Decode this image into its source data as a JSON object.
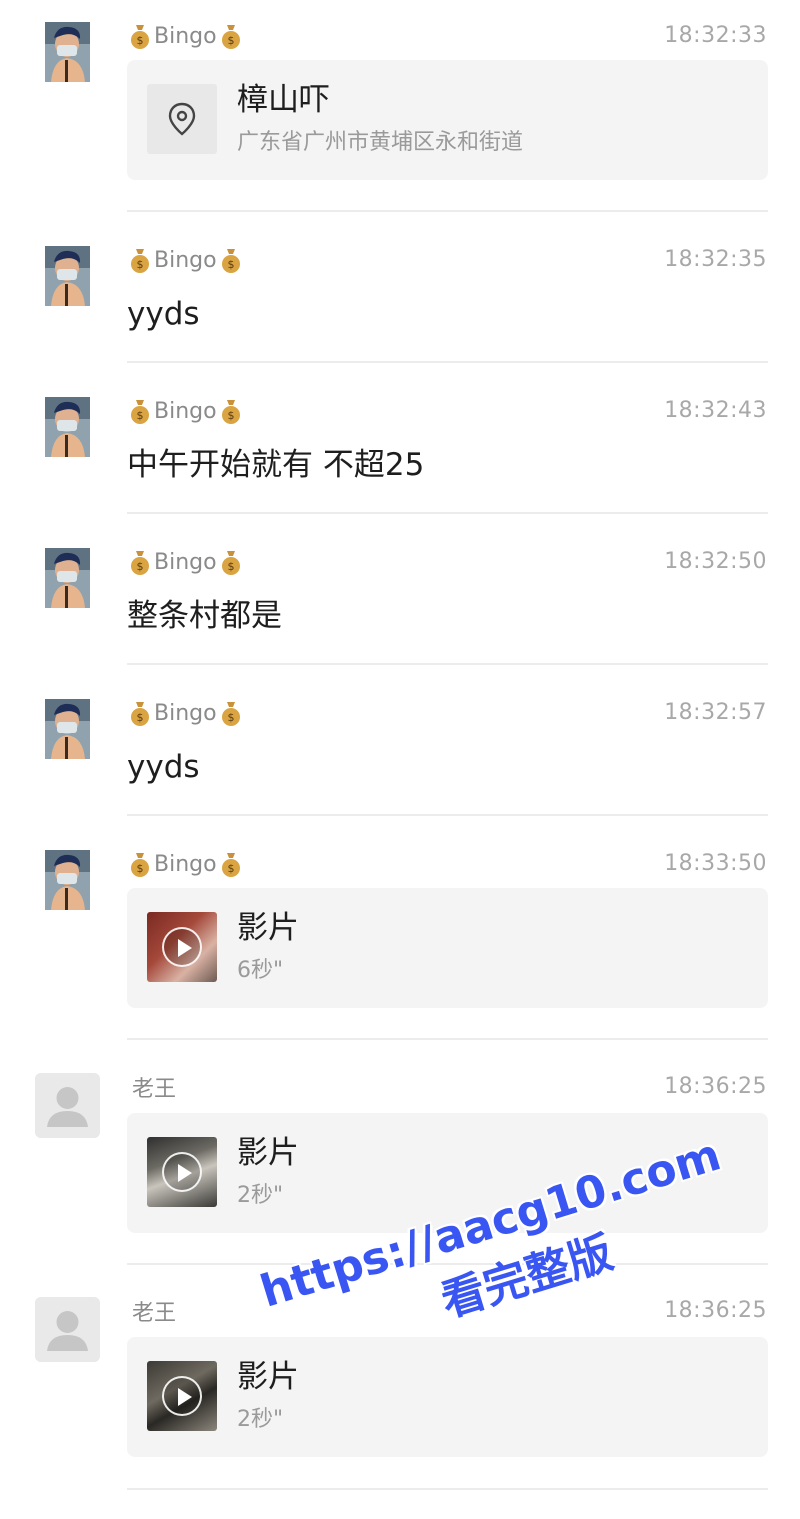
{
  "colors": {
    "background": "#ffffff",
    "card_background": "#f4f4f4",
    "sender_text": "#8a8a8a",
    "timestamp_text": "#a8a8a8",
    "watermark": "#3a56f2"
  },
  "messages": [
    {
      "sender": "Bingo",
      "sender_decoration_icon": "money-bag-icon",
      "avatar": "user-photo",
      "time": "18:32:33",
      "type": "location",
      "location": {
        "icon": "location-pin-icon",
        "title": "樟山吓",
        "address": "广东省广州市黄埔区永和街道"
      }
    },
    {
      "sender": "Bingo",
      "sender_decoration_icon": "money-bag-icon",
      "avatar": "user-photo",
      "time": "18:32:35",
      "type": "text",
      "text": "yyds"
    },
    {
      "sender": "Bingo",
      "sender_decoration_icon": "money-bag-icon",
      "avatar": "user-photo",
      "time": "18:32:43",
      "type": "text",
      "text": "中午开始就有 不超25"
    },
    {
      "sender": "Bingo",
      "sender_decoration_icon": "money-bag-icon",
      "avatar": "user-photo",
      "time": "18:32:50",
      "type": "text",
      "text": "整条村都是"
    },
    {
      "sender": "Bingo",
      "sender_decoration_icon": "money-bag-icon",
      "avatar": "user-photo",
      "time": "18:32:57",
      "type": "text",
      "text": "yyds"
    },
    {
      "sender": "Bingo",
      "sender_decoration_icon": "money-bag-icon",
      "avatar": "user-photo",
      "time": "18:33:50",
      "type": "video",
      "video": {
        "icon": "play-icon",
        "title": "影片",
        "duration": "6秒\""
      }
    },
    {
      "sender": "老王",
      "avatar": "default-avatar",
      "time": "18:36:25",
      "type": "video",
      "video": {
        "icon": "play-icon",
        "title": "影片",
        "duration": "2秒\""
      }
    },
    {
      "sender": "老王",
      "avatar": "default-avatar",
      "time": "18:36:25",
      "type": "video",
      "video": {
        "icon": "play-icon",
        "title": "影片",
        "duration": "2秒\""
      }
    }
  ],
  "watermark": {
    "url": "https://aacg10.com",
    "caption": "看完整版"
  }
}
